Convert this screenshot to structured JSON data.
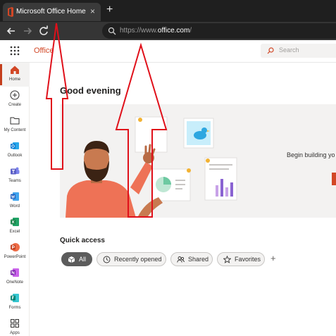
{
  "browser": {
    "tab_title": "Microsoft Office Home",
    "tab_close": "×",
    "new_tab": "+",
    "url_prefix": "https://www.",
    "url_host": "office.com",
    "url_suffix": "/"
  },
  "header": {
    "brand": "Office",
    "search_placeholder": "Search"
  },
  "sidebar": {
    "items": [
      {
        "label": "Home",
        "icon": "home-icon",
        "color": "#d24726"
      },
      {
        "label": "Create",
        "icon": "create-icon",
        "color": "#323130"
      },
      {
        "label": "My Content",
        "icon": "folder-icon",
        "color": "#323130"
      },
      {
        "label": "Outlook",
        "icon": "outlook-icon",
        "color": "#0078d4"
      },
      {
        "label": "Teams",
        "icon": "teams-icon",
        "color": "#5b5fc7"
      },
      {
        "label": "Word",
        "icon": "word-icon",
        "color": "#185abd"
      },
      {
        "label": "Excel",
        "icon": "excel-icon",
        "color": "#107c41"
      },
      {
        "label": "PowerPoint",
        "icon": "powerpoint-icon",
        "color": "#c43e1c"
      },
      {
        "label": "OneNote",
        "icon": "onenote-icon",
        "color": "#7719aa"
      },
      {
        "label": "Forms",
        "icon": "forms-icon",
        "color": "#008272"
      },
      {
        "label": "Apps",
        "icon": "apps-icon",
        "color": "#323130"
      }
    ]
  },
  "main": {
    "greeting": "Good evening",
    "hero_text": "Begin building yo",
    "quick_access_title": "Quick access",
    "filters": [
      "All",
      "Recently opened",
      "Shared",
      "Favorites"
    ],
    "add_label": "+"
  },
  "colors": {
    "accent": "#d24726",
    "annotation_arrow": "#e0101a"
  }
}
